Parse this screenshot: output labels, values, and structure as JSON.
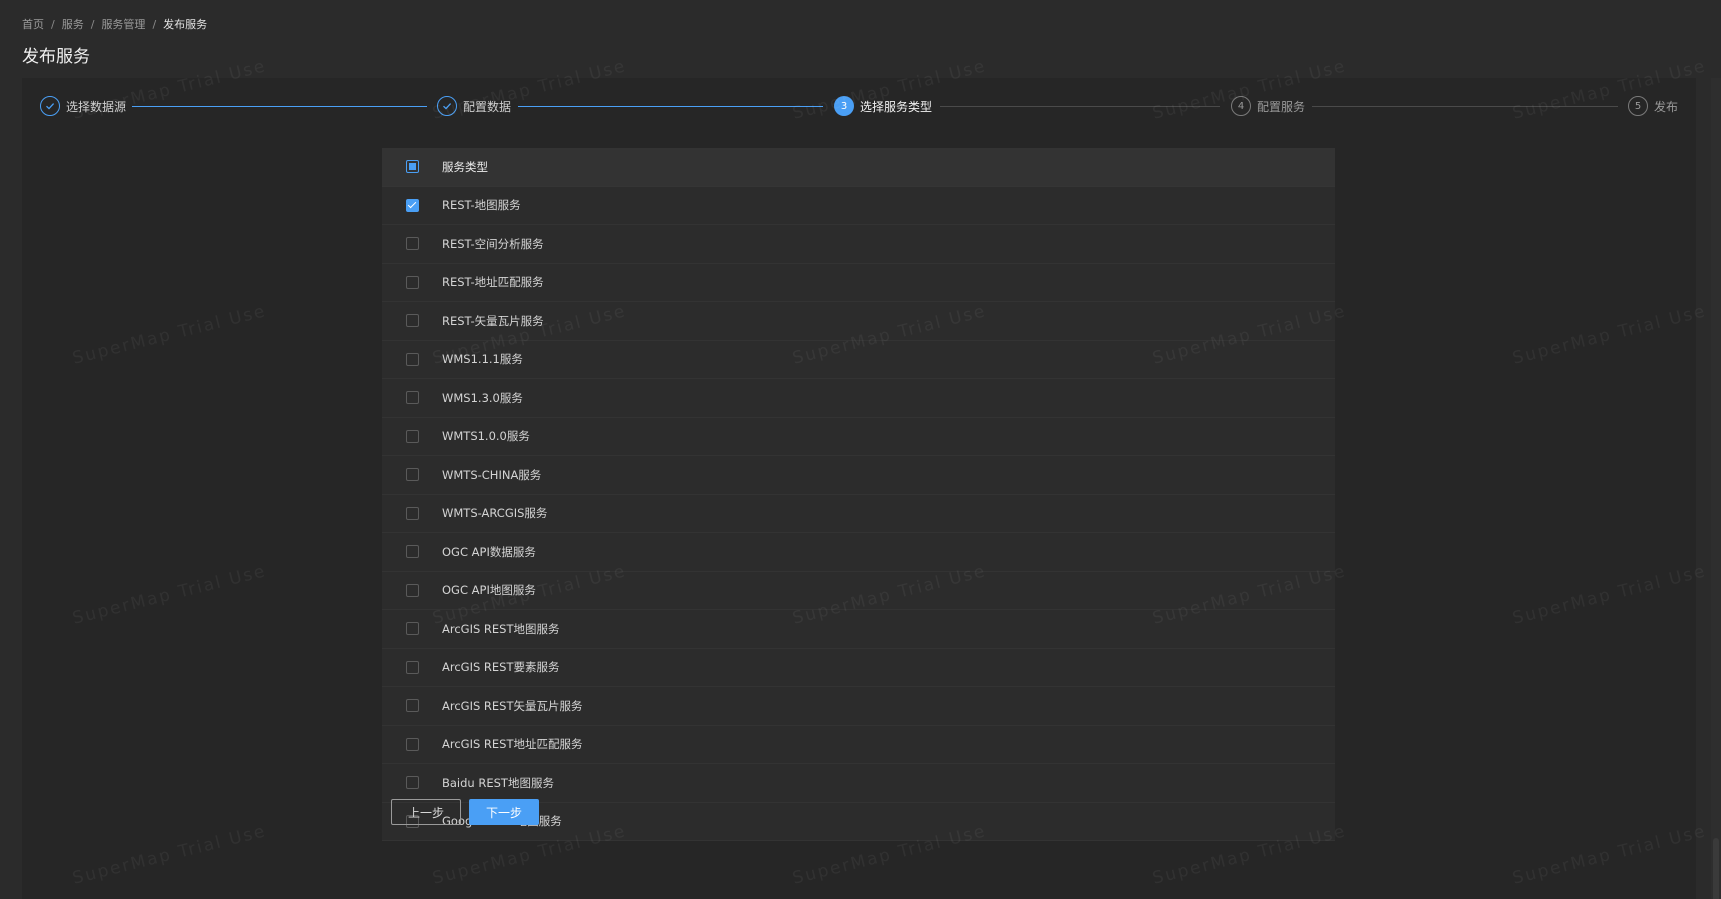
{
  "breadcrumb": {
    "items": [
      "首页",
      "服务",
      "服务管理"
    ],
    "current": "发布服务",
    "separator": "/"
  },
  "page_title": "发布服务",
  "steps": [
    {
      "index": "1",
      "label": "选择数据源",
      "status": "done"
    },
    {
      "index": "2",
      "label": "配置数据",
      "status": "done"
    },
    {
      "index": "3",
      "label": "选择服务类型",
      "status": "active"
    },
    {
      "index": "4",
      "label": "配置服务",
      "status": "wait"
    },
    {
      "index": "5",
      "label": "发布",
      "status": "wait"
    }
  ],
  "table": {
    "header": "服务类型",
    "header_checkbox_state": "indeterminate",
    "rows": [
      {
        "label": "REST-地图服务",
        "checked": true
      },
      {
        "label": "REST-空间分析服务",
        "checked": false
      },
      {
        "label": "REST-地址匹配服务",
        "checked": false
      },
      {
        "label": "REST-矢量瓦片服务",
        "checked": false
      },
      {
        "label": "WMS1.1.1服务",
        "checked": false
      },
      {
        "label": "WMS1.3.0服务",
        "checked": false
      },
      {
        "label": "WMTS1.0.0服务",
        "checked": false
      },
      {
        "label": "WMTS-CHINA服务",
        "checked": false
      },
      {
        "label": "WMTS-ARCGIS服务",
        "checked": false
      },
      {
        "label": "OGC API数据服务",
        "checked": false
      },
      {
        "label": "OGC API地图服务",
        "checked": false
      },
      {
        "label": "ArcGIS REST地图服务",
        "checked": false
      },
      {
        "label": "ArcGIS REST要素服务",
        "checked": false
      },
      {
        "label": "ArcGIS REST矢量瓦片服务",
        "checked": false
      },
      {
        "label": "ArcGIS REST地址匹配服务",
        "checked": false
      },
      {
        "label": "Baidu REST地图服务",
        "checked": false
      },
      {
        "label": "Google REST地图服务",
        "checked": false
      }
    ]
  },
  "buttons": {
    "prev_label": "上一步",
    "next_label": "下一步"
  },
  "watermark_text": "SuperMap Trial Use",
  "colors": {
    "accent": "#4a9ff5",
    "background": "#2b2b2b",
    "panel": "#262626"
  }
}
